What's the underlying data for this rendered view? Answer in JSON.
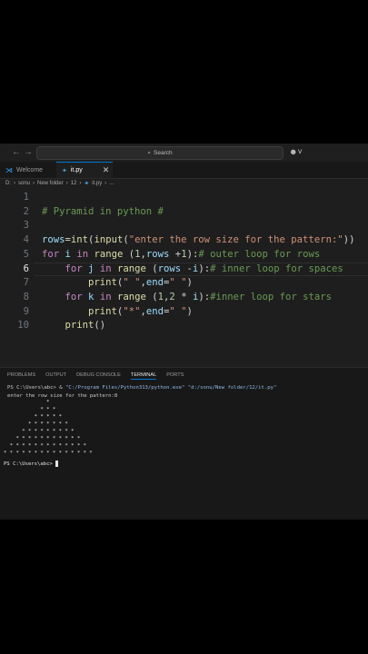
{
  "search": {
    "label": "Search"
  },
  "tabs": [
    {
      "label": "Welcome"
    },
    {
      "label": "it.py",
      "active": true
    }
  ],
  "breadcrumb": [
    "D:",
    "sonu",
    "New folder",
    "12",
    "it.py",
    "..."
  ],
  "editor": {
    "current_line": 6,
    "lines": [
      {
        "n": "1",
        "code": ""
      },
      {
        "n": "2",
        "code": "# Pyramid in python #"
      },
      {
        "n": "3",
        "code": ""
      },
      {
        "n": "4",
        "code": "rows=int(input(\"enter the row size for the pattern:\"))"
      },
      {
        "n": "5",
        "code": "for i in range (1,rows +1):# outer loop for rows"
      },
      {
        "n": "6",
        "code": "    for j in range (rows -i):# inner loop for spaces"
      },
      {
        "n": "7",
        "code": "        print(\" \",end=\" \")"
      },
      {
        "n": "8",
        "code": "    for k in range (1,2 * i):#inner loop for stars"
      },
      {
        "n": "9",
        "code": "        print(\"*\",end=\" \")"
      },
      {
        "n": "10",
        "code": "    print()"
      }
    ]
  },
  "panel": {
    "tabs": [
      "PROBLEMS",
      "OUTPUT",
      "DEBUG CONSOLE",
      "TERMINAL",
      "PORTS"
    ],
    "active_tab": "TERMINAL",
    "terminal": {
      "line1_prompt": "PS C:\\Users\\abc> & ",
      "line1_cmd": "\"C:/Program Files/Python313/python.exe\" \"d:/sonu/New folder/12/it.py\"",
      "line2": "enter the row size for the pattern:8",
      "pyramid": [
        "              *",
        "            * * *",
        "          * * * * *",
        "        * * * * * * *",
        "      * * * * * * * * *",
        "    * * * * * * * * * * *",
        "  * * * * * * * * * * * * *",
        "* * * * * * * * * * * * * * *"
      ],
      "final_prompt": "PS C:\\Users\\abc> "
    }
  }
}
